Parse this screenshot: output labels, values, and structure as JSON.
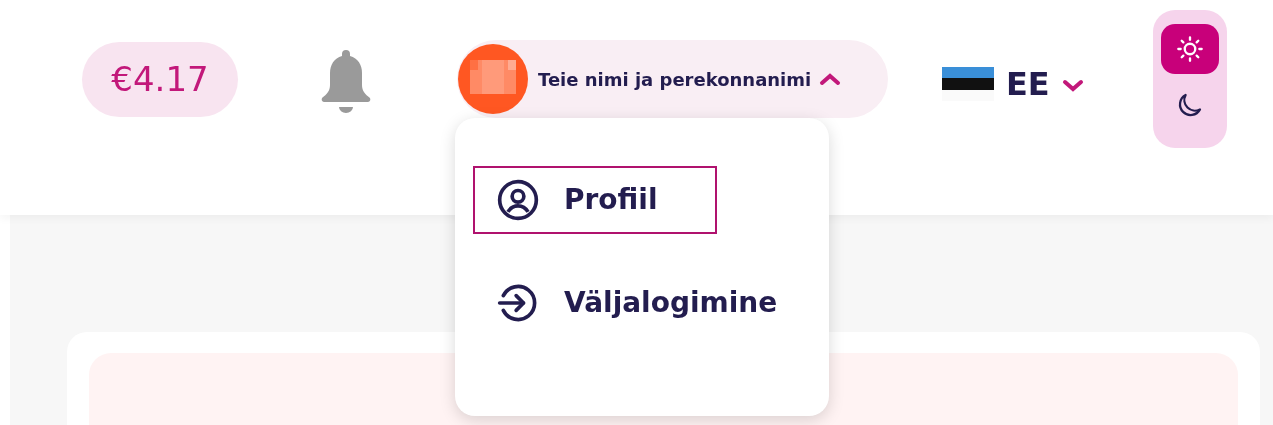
{
  "balance": "€4.17",
  "user_menu": {
    "name": "Teie nimi ja perekonnanimi",
    "expanded": true,
    "items": [
      {
        "label": "Profiil",
        "kind": "profile",
        "selected": true
      },
      {
        "label": "Väljalogimine",
        "kind": "logout",
        "selected": false
      }
    ]
  },
  "language": {
    "code": "EE"
  },
  "theme_toggle": [
    {
      "kind": "light",
      "selected": true
    },
    {
      "kind": "dark",
      "selected": false
    }
  ]
}
